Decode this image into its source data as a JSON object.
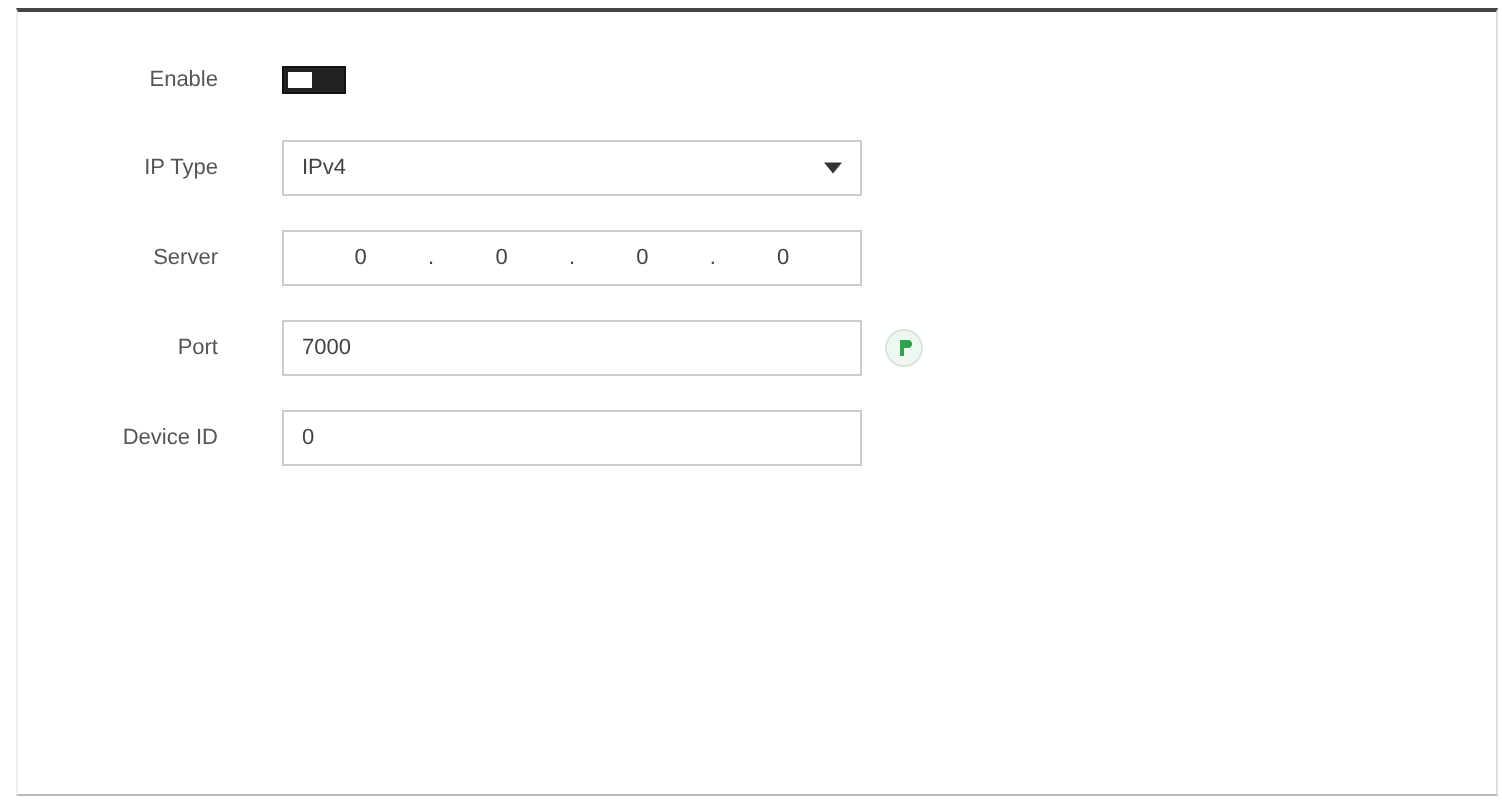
{
  "enable": {
    "label": "Enable",
    "on": false
  },
  "ip_type": {
    "label": "IP Type",
    "value": "IPv4"
  },
  "server": {
    "label": "Server",
    "octets": [
      "0",
      "0",
      "0",
      "0"
    ],
    "separator": "."
  },
  "port": {
    "label": "Port",
    "value": "7000"
  },
  "device_id": {
    "label": "Device ID",
    "value": "0"
  }
}
